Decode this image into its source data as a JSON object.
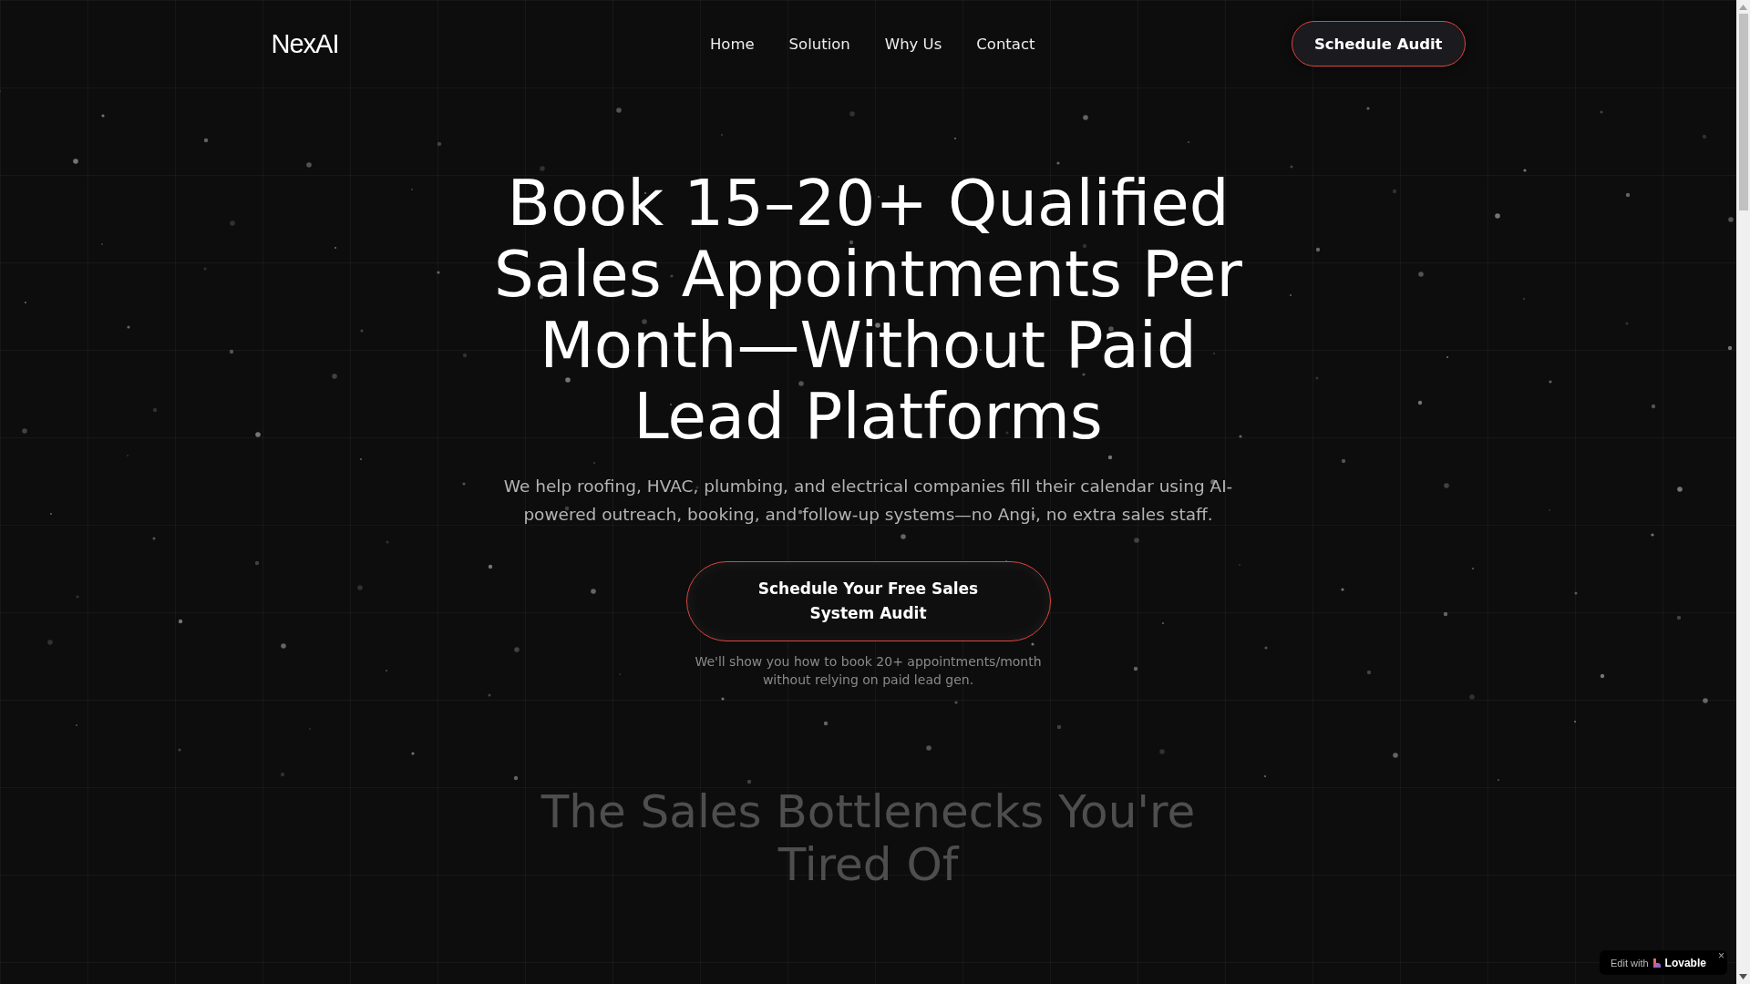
{
  "header": {
    "logo": "NexAI",
    "nav": [
      {
        "label": "Home"
      },
      {
        "label": "Solution"
      },
      {
        "label": "Why Us"
      },
      {
        "label": "Contact"
      }
    ],
    "cta": "Schedule Audit"
  },
  "hero": {
    "title": "Book 15–20+ Qualified Sales Appointments Per Month—Without Paid Lead Platforms",
    "subtitle": "We help roofing, HVAC, plumbing, and electrical companies fill their calendar using AI-powered outreach, booking, and follow-up systems—no Angi, no extra sales staff.",
    "cta": "Schedule Your Free Sales System Audit",
    "note": "We'll show you how to book 20+ appointments/month without relying on paid lead gen."
  },
  "next_section": {
    "title": "The Sales Bottlenecks You're Tired Of"
  },
  "badge": {
    "prefix": "Edit with",
    "brand": "Lovable",
    "close": "×"
  }
}
